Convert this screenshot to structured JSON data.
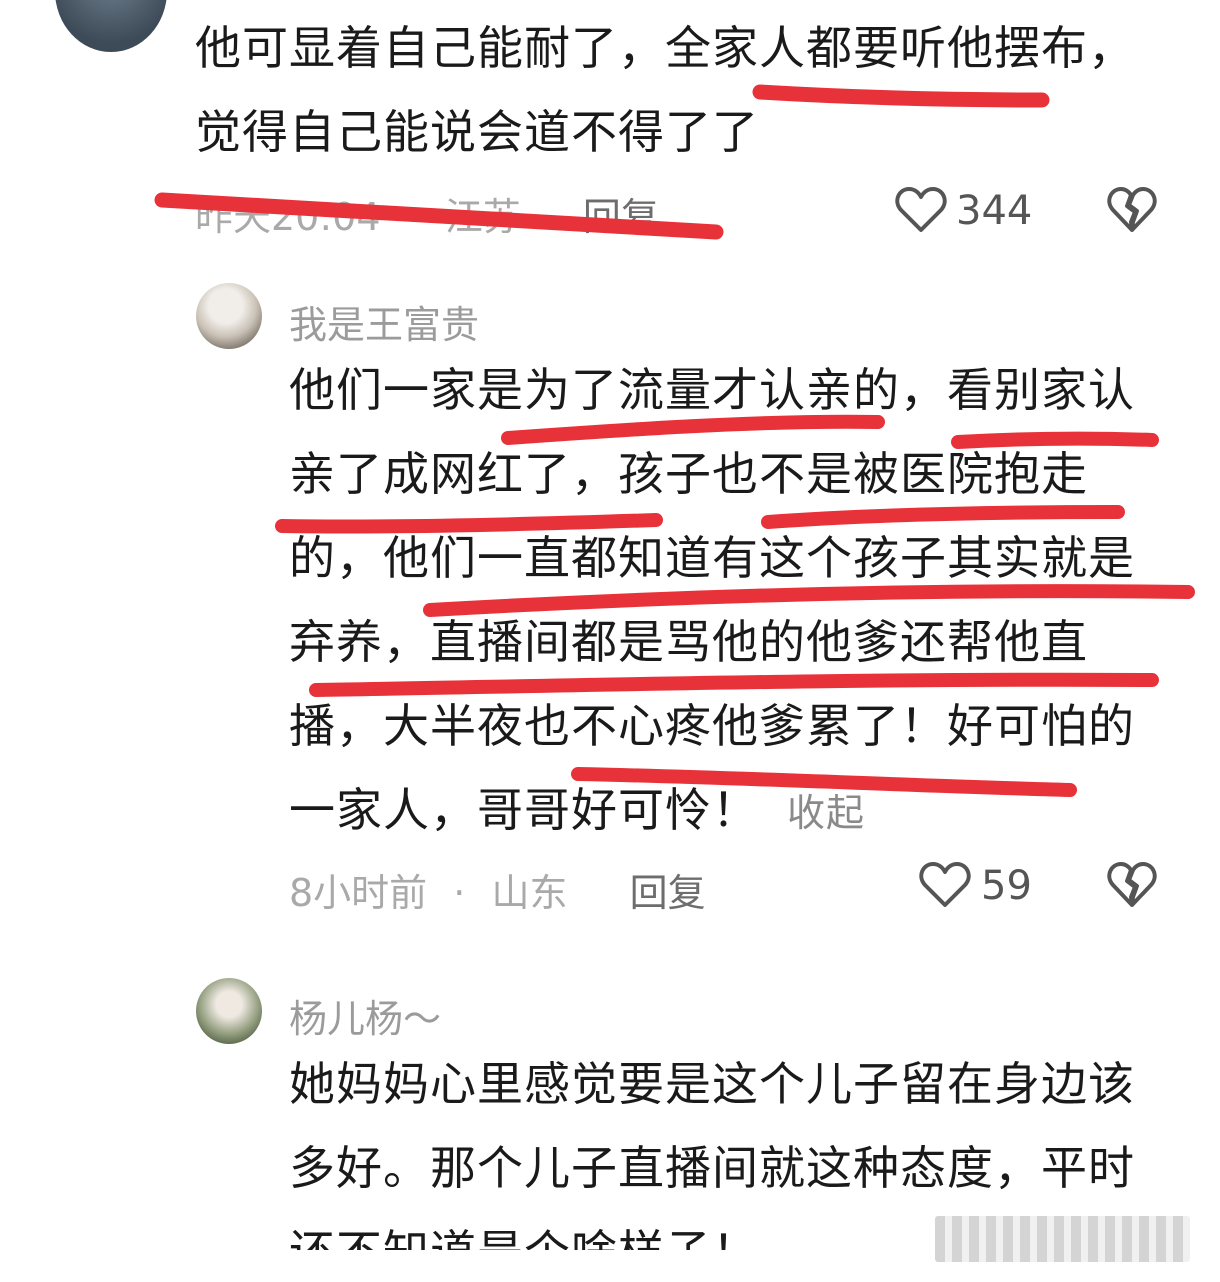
{
  "comments": [
    {
      "lines": [
        "他可显着自己能耐了，全家人都要听他摆布，",
        "觉得自己能说会道不得了了"
      ],
      "time": "昨天20:04",
      "location": "江苏",
      "reply_label": "回复",
      "likes": "344"
    },
    {
      "username": "我是王富贵",
      "lines": [
        "他们一家是为了流量才认亲的，看别家认",
        "亲了成网红了，孩子也不是被医院抱走",
        "的，他们一直都知道有这个孩子其实就是",
        "弃养，直播间都是骂他的他爹还帮他直",
        "播，大半夜也不心疼他爹累了！好可怕的",
        "一家人，哥哥好可怜！"
      ],
      "collapse_label": "收起",
      "time": "8小时前",
      "location": "山东",
      "reply_label": "回复",
      "likes": "59"
    },
    {
      "username": "杨儿杨～",
      "lines": [
        "她妈妈心里感觉要是这个儿子留在身边该",
        "多好。那个儿子直播间就这种态度，平时",
        "还不知道是个啥样子！"
      ]
    }
  ],
  "separator": "·",
  "icons": {
    "like": "heart-outline-icon",
    "dislike": "broken-heart-icon"
  },
  "colors": {
    "underline": "#e8323a",
    "meta": "#a9a9a9",
    "text": "#1a1a1a"
  }
}
